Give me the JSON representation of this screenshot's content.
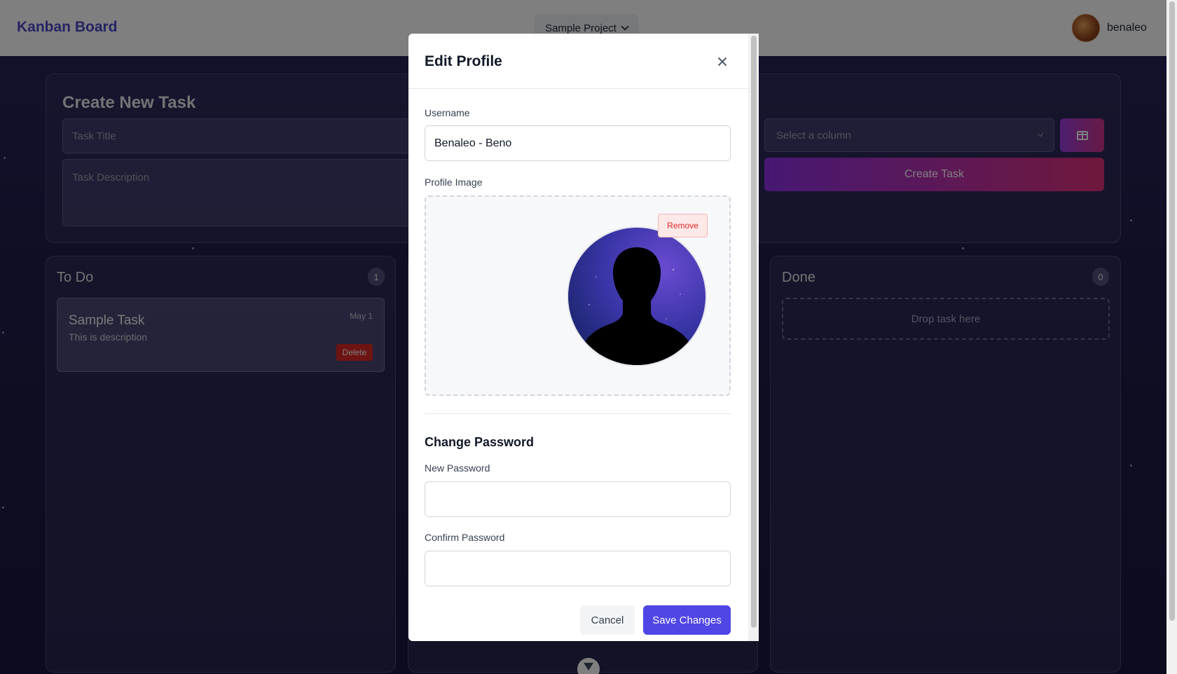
{
  "header": {
    "brand": "Kanban Board",
    "project_selector": "Sample Project",
    "username": "benaleo"
  },
  "create_task": {
    "title": "Create New Task",
    "task_title_placeholder": "Task Title",
    "task_description_placeholder": "Task Description",
    "column_select_placeholder": "Select a column",
    "board_button_icon": "board-columns-icon",
    "create_button": "Create Task"
  },
  "columns": [
    {
      "title": "To Do",
      "count": "1",
      "tasks": [
        {
          "title": "Sample Task",
          "description": "This is description",
          "date": "May 1",
          "delete_label": "Delete"
        }
      ]
    },
    {
      "title": "",
      "count": "",
      "tasks": []
    },
    {
      "title": "Done",
      "count": "0",
      "drop_hint": "Drop task here",
      "tasks": []
    }
  ],
  "modal": {
    "title": "Edit Profile",
    "close_icon": "close-icon",
    "username_label": "Username",
    "username_value": "Benaleo - Beno",
    "profile_image_label": "Profile Image",
    "remove_label": "Remove",
    "change_password_title": "Change Password",
    "new_password_label": "New Password",
    "new_password_value": "",
    "confirm_password_label": "Confirm Password",
    "confirm_password_value": "",
    "cancel_label": "Cancel",
    "save_label": "Save Changes"
  },
  "colors": {
    "brand": "#4a46c8",
    "primary_button": "#4f46e5",
    "danger": "#dc2626",
    "gradient_start": "#8e31e6",
    "gradient_end": "#e0307a"
  }
}
